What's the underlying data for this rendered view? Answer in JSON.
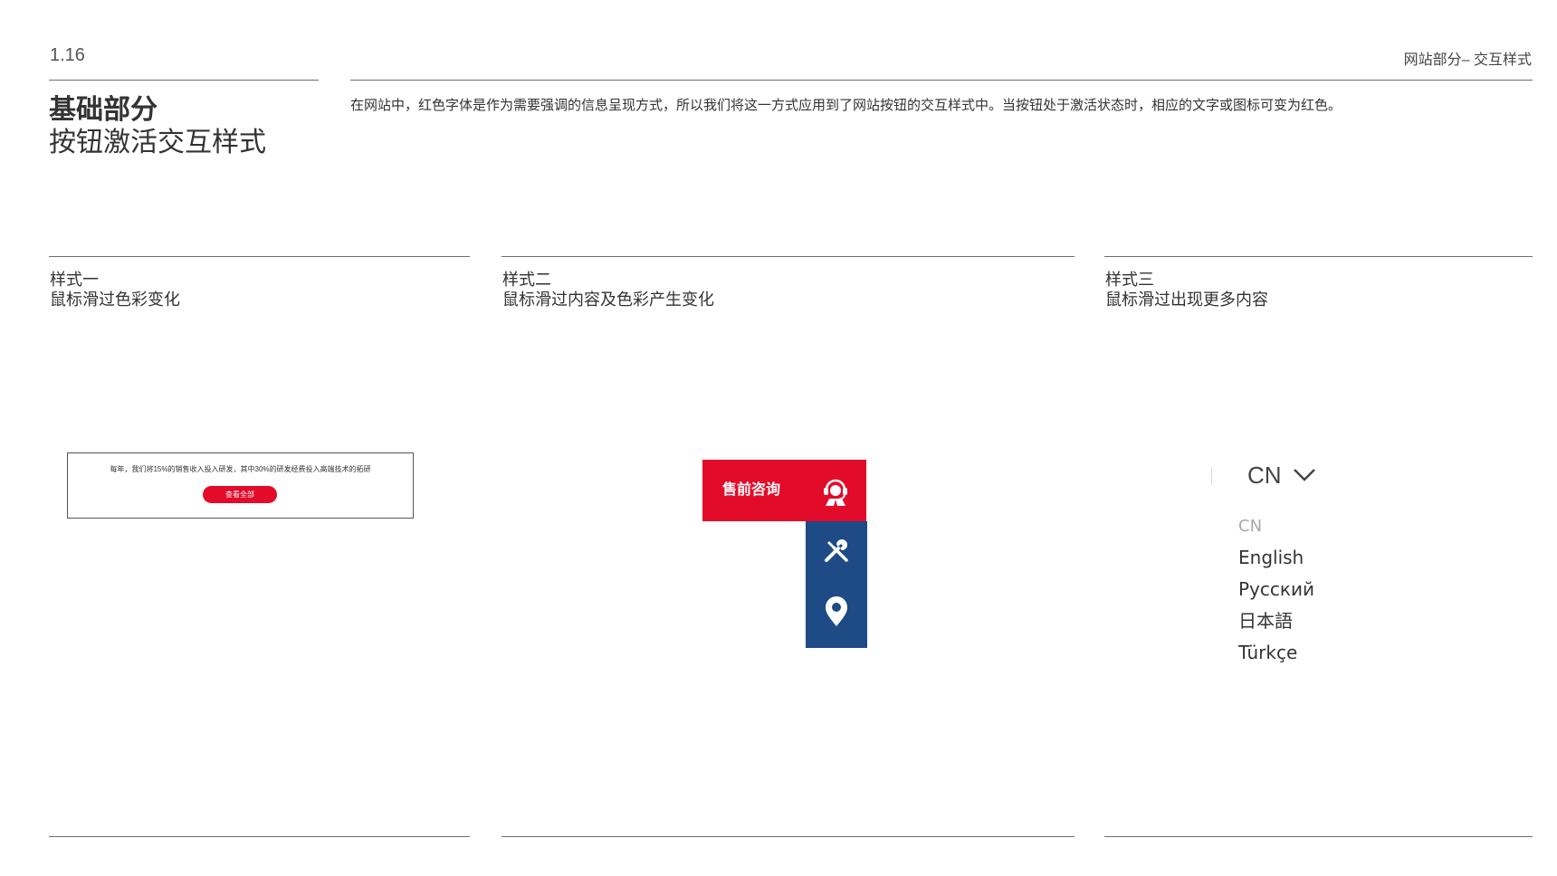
{
  "header": {
    "page_number": "1.16",
    "section": "网站部分– 交互样式"
  },
  "intro": {
    "title_main": "基础部分",
    "title_sub": "按钮激活交互样式",
    "description": "在网站中，红色字体是作为需要强调的信息呈现方式，所以我们将这一方式应用到了网站按钮的交互样式中。当按钮处于激活状态时，相应的文字或图标可变为红色。"
  },
  "columns": [
    {
      "label": "样式一",
      "caption": "鼠标滑过色彩变化"
    },
    {
      "label": "样式二",
      "caption": "鼠标滑过内容及色彩产生变化"
    },
    {
      "label": "样式三",
      "caption": "鼠标滑过出现更多内容"
    }
  ],
  "demo1": {
    "text": "每年，我们将15%的销售收入投入研发，其中30%的研发经费投入高端技术的拓研",
    "button_label": "查看全部"
  },
  "demo2": {
    "consult_label": "售前咨询",
    "icons": [
      "customer-service-icon",
      "tools-icon",
      "location-pin-icon"
    ]
  },
  "demo3": {
    "current_language": "CN",
    "languages": [
      "CN",
      "English",
      "Русский",
      "日本語",
      "Türkçe"
    ]
  },
  "colors": {
    "accent_red": "#e30b2a",
    "navy": "#1e4a85",
    "rule": "#6e6e6e"
  }
}
